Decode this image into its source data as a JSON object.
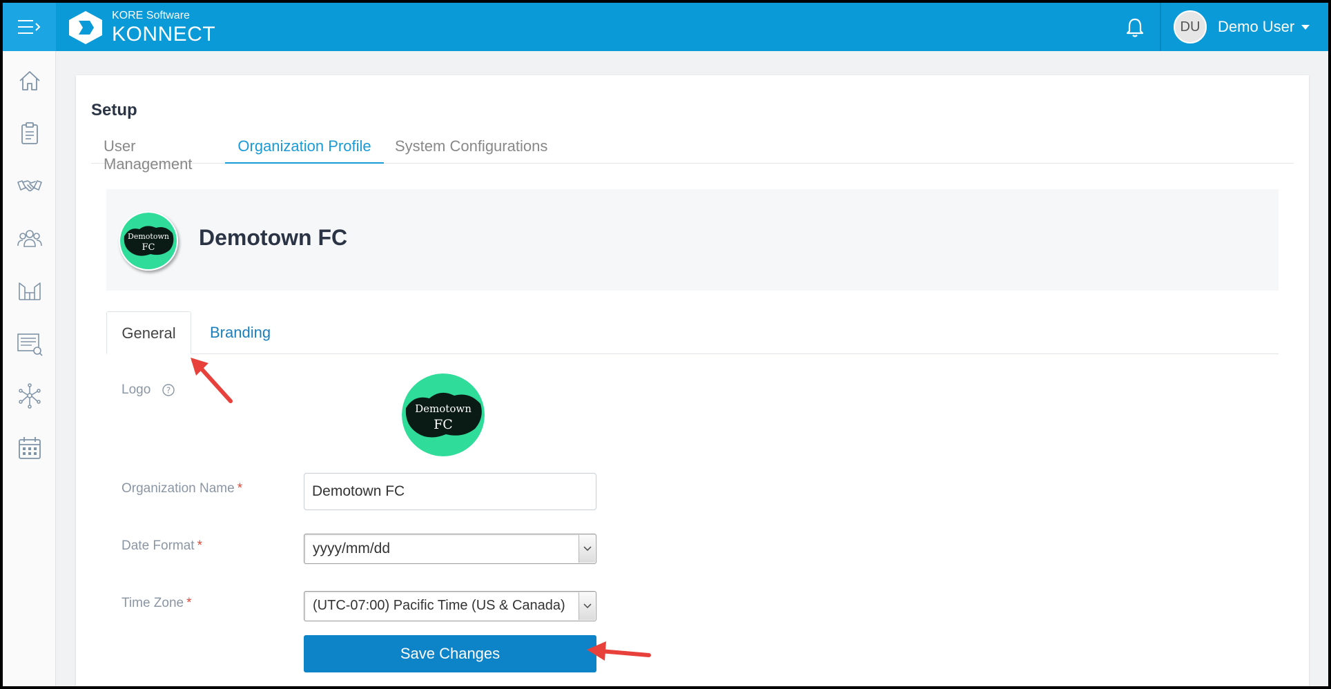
{
  "header": {
    "brand_sub": "KORE Software",
    "brand_name": "KONNECT",
    "user_initials": "DU",
    "user_name": "Demo User"
  },
  "sidebar": {
    "items": [
      {
        "icon": "home-icon"
      },
      {
        "icon": "clipboard-icon"
      },
      {
        "icon": "handshake-icon"
      },
      {
        "icon": "users-icon"
      },
      {
        "icon": "venue-icon"
      },
      {
        "icon": "search-list-icon"
      },
      {
        "icon": "network-icon"
      },
      {
        "icon": "calendar-icon"
      }
    ]
  },
  "page": {
    "title": "Setup",
    "tabs": [
      {
        "label": "User Management",
        "active": false
      },
      {
        "label": "Organization Profile",
        "active": true
      },
      {
        "label": "System Configurations",
        "active": false
      }
    ]
  },
  "org": {
    "name": "Demotown FC",
    "logo_text_line1": "Demotown",
    "logo_text_line2": "FC"
  },
  "subtabs": [
    {
      "label": "General",
      "active": true
    },
    {
      "label": "Branding",
      "active": false
    }
  ],
  "form": {
    "logo_label": "Logo",
    "org_name_label": "Organization Name",
    "org_name_value": "Demotown FC",
    "date_format_label": "Date Format",
    "date_format_value": "yyyy/mm/dd",
    "time_zone_label": "Time Zone",
    "time_zone_value": "(UTC-07:00) Pacific Time (US & Canada)",
    "required_mark": "*",
    "save_label": "Save Changes"
  },
  "colors": {
    "topbar": "#0a9ad8",
    "accent": "#1a9ad6",
    "button": "#0d84c7",
    "logo_green": "#2fdc9a",
    "annotation_arrow": "#e8403a"
  }
}
